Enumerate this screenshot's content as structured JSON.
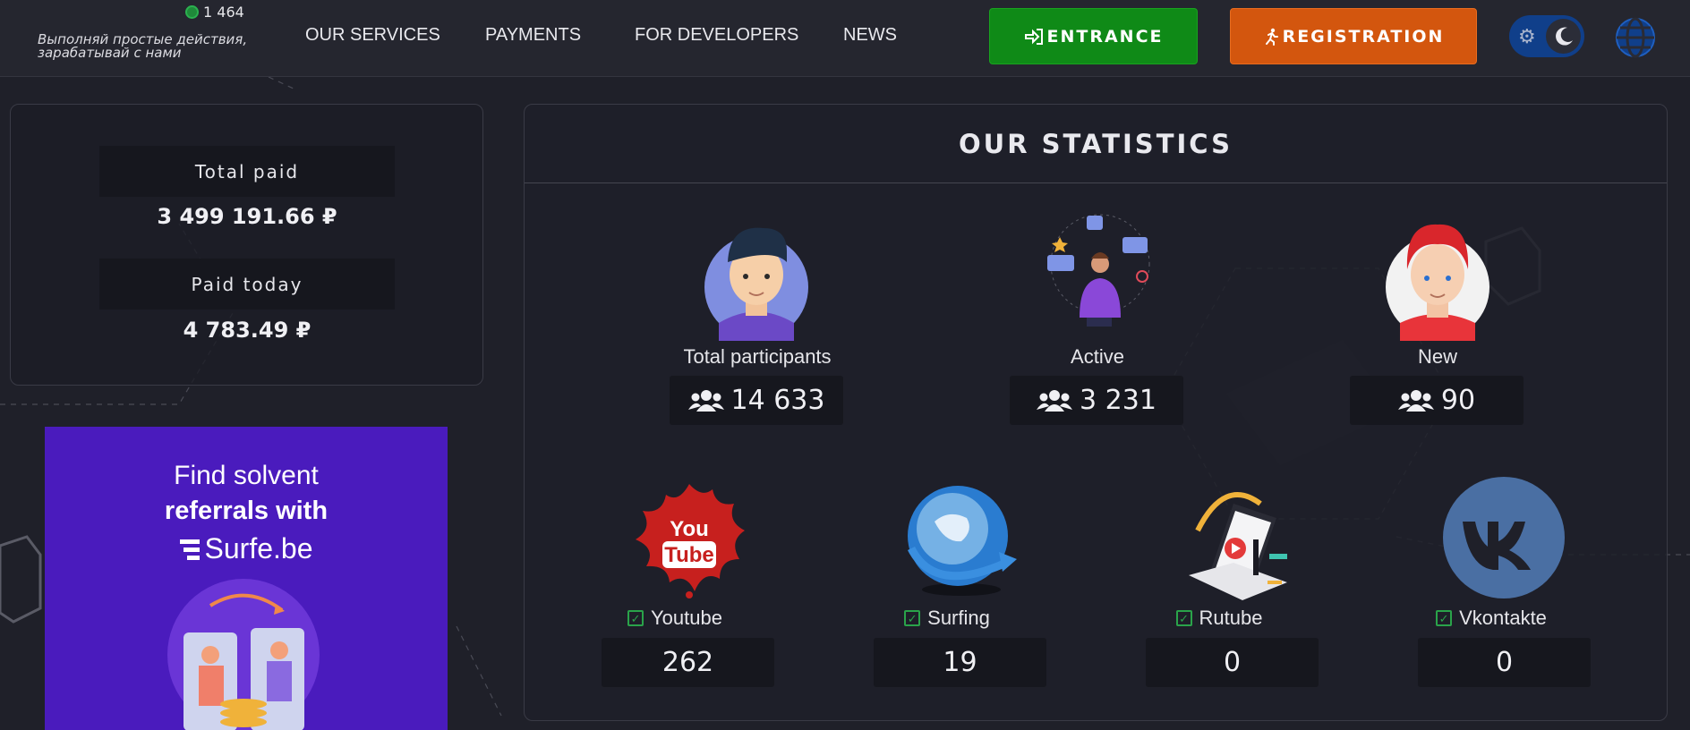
{
  "header": {
    "online_count": "1 464",
    "tagline": "Выполняй простые действия, зарабатывай с нами",
    "nav": [
      "OUR SERVICES",
      "PAYMENTS",
      "FOR DEVELOPERS",
      "NEWS"
    ],
    "entrance_label": "ENTRANCE",
    "registration_label": "REGISTRATION"
  },
  "payouts": {
    "total_paid_label": "Total paid",
    "total_paid_value": "3 499 191.66 ₽",
    "paid_today_label": "Paid today",
    "paid_today_value": "4 783.49 ₽"
  },
  "ad": {
    "line1": "Find solvent",
    "line2": "referrals with",
    "brand": "Surfe.be"
  },
  "stats": {
    "title": "OUR STATISTICS",
    "participants": [
      {
        "label": "Total participants",
        "value": "14 633"
      },
      {
        "label": "Active",
        "value": "3 231"
      },
      {
        "label": "New",
        "value": "90"
      }
    ],
    "services": [
      {
        "label": "Youtube",
        "value": "262",
        "icon": "youtube-icon"
      },
      {
        "label": "Surfing",
        "value": "19",
        "icon": "globe-arrow-icon"
      },
      {
        "label": "Rutube",
        "value": "0",
        "icon": "rutube-icon"
      },
      {
        "label": "Vkontakte",
        "value": "0",
        "icon": "vk-icon"
      }
    ]
  },
  "colors": {
    "background": "#1f2029",
    "entrance": "#0f8a17",
    "registration": "#d3560e",
    "toggle": "#103f8a",
    "ad": "#4a1bbd",
    "check": "#2aa34a"
  }
}
